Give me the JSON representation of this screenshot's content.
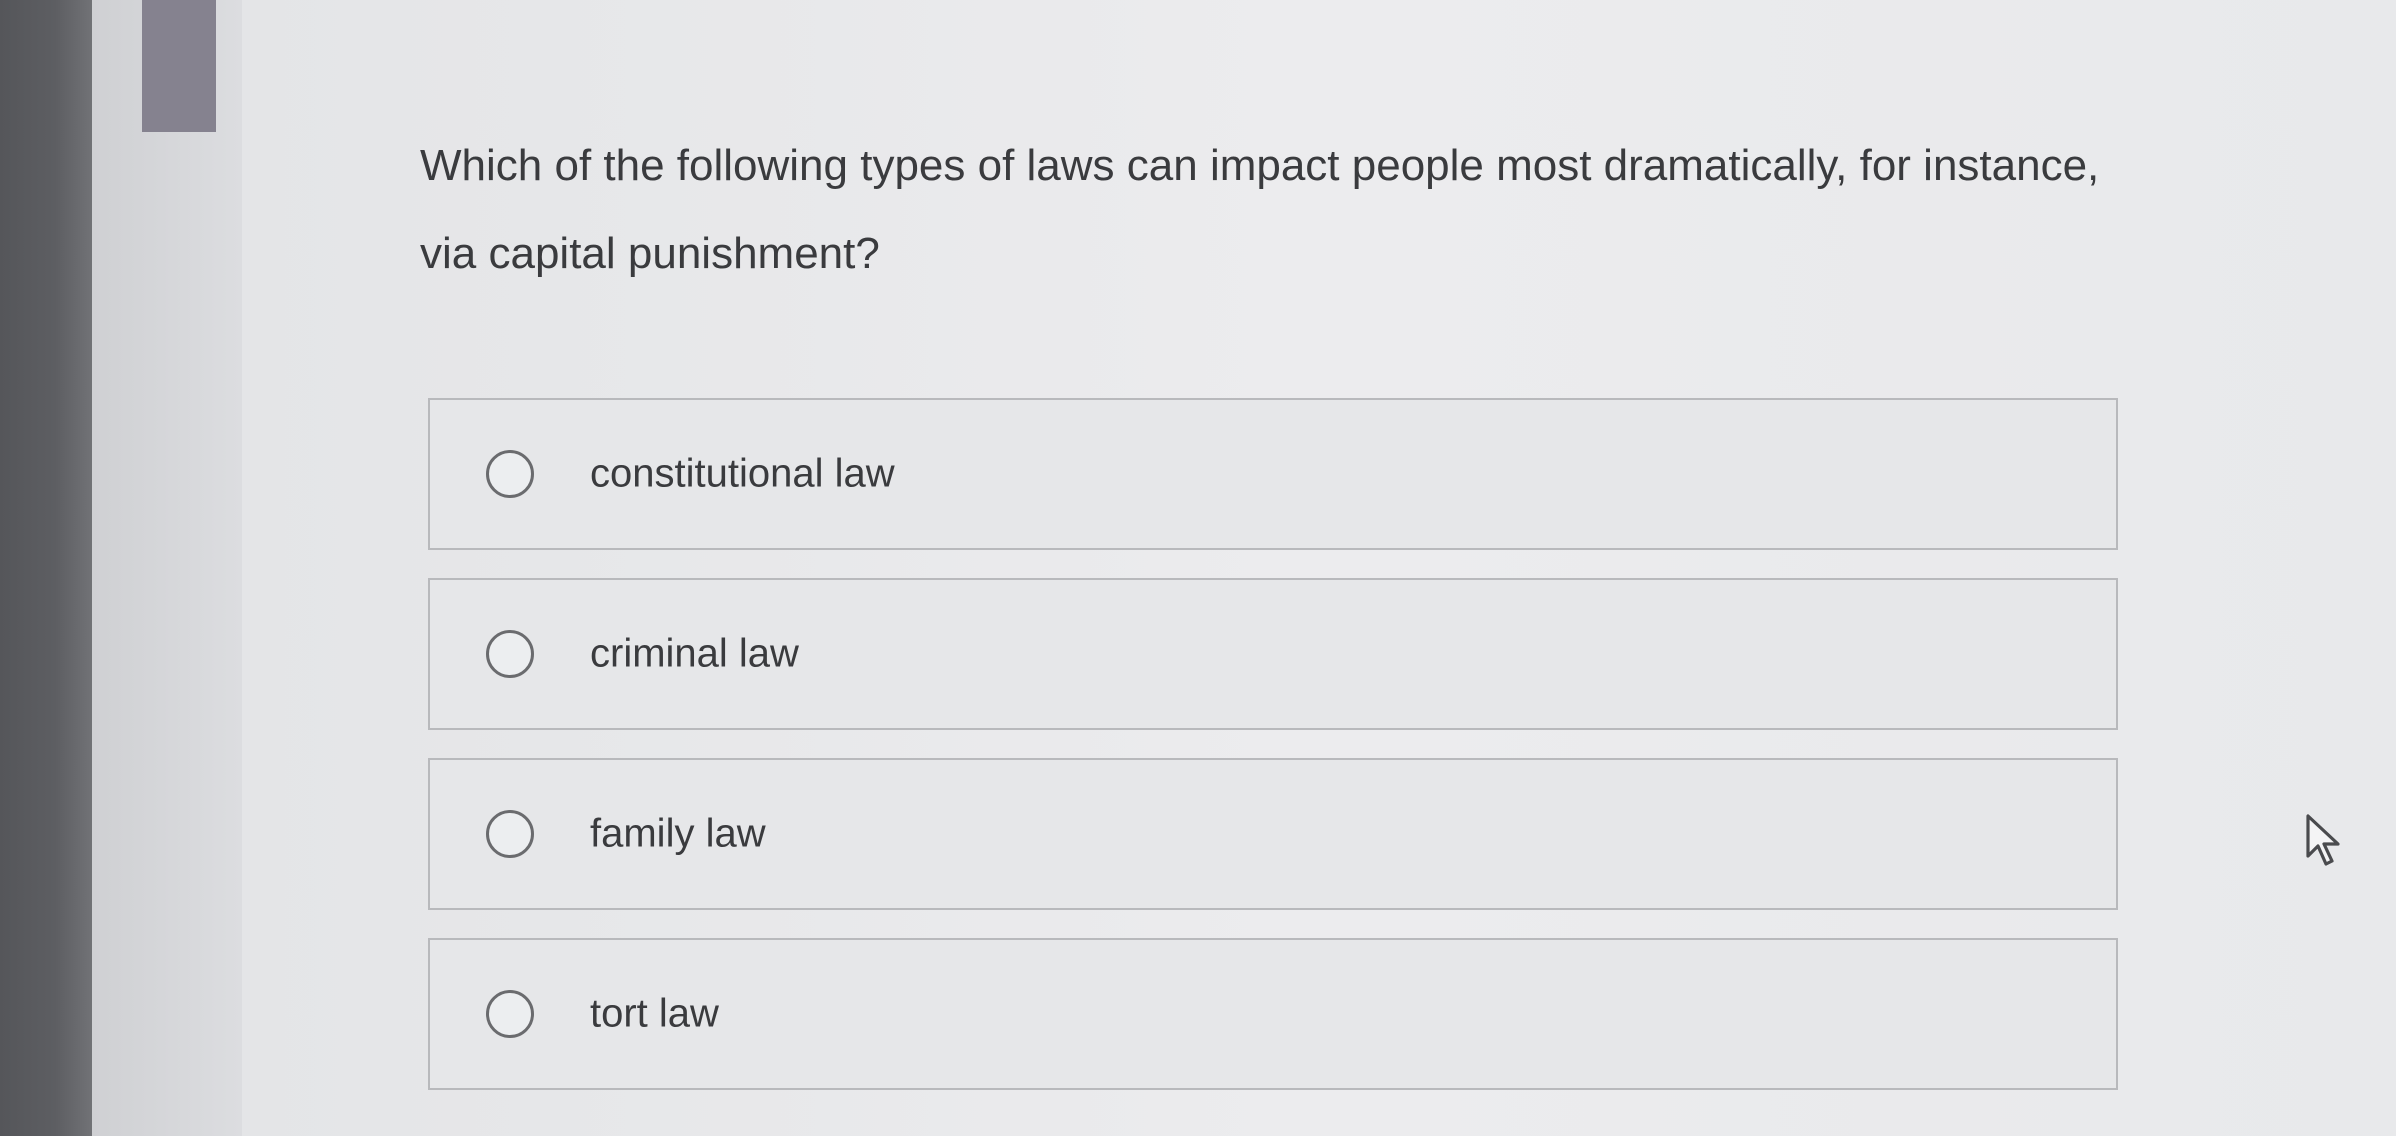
{
  "question": {
    "text": "Which of the following types of laws can impact people most dramatically, for instance, via capital punishment?"
  },
  "options": [
    {
      "label": "constitutional law",
      "selected": false
    },
    {
      "label": "criminal law",
      "selected": false
    },
    {
      "label": "family law",
      "selected": false
    },
    {
      "label": "tort law",
      "selected": false
    }
  ],
  "icons": {
    "radio": "radio-button-unchecked",
    "cursor": "mouse-pointer"
  },
  "colors": {
    "text": "#3a3b3e",
    "border": "#b8b9bc",
    "background": "#e9eaec"
  }
}
